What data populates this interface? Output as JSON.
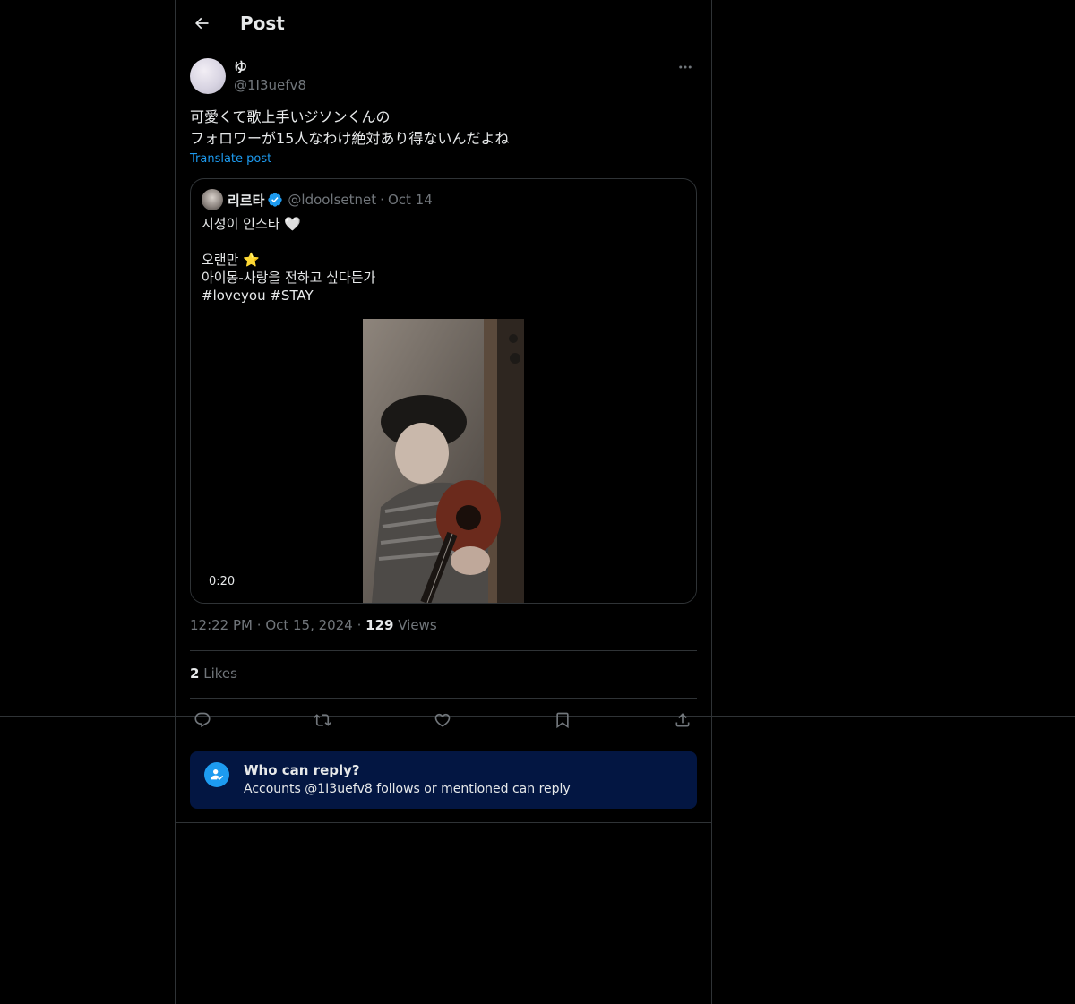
{
  "header": {
    "title": "Post"
  },
  "post": {
    "display_name": "ゆ",
    "handle": "@1I3uefv8",
    "text": "可愛くて歌上手いジソンくんの\nフォロワーが15人なわけ絶対あり得ないんだよね",
    "translate_label": "Translate post",
    "time": "12:22 PM",
    "date": "Oct 15, 2024",
    "views_count": "129",
    "views_label": "Views",
    "likes_count": "2",
    "likes_label": "Likes"
  },
  "quote": {
    "display_name": "리르타",
    "handle": "@ldoolsetnet",
    "date": "Oct 14",
    "lines": [
      "지성이 인스타 🤍",
      "오랜만 ⭐",
      "아이몽-사랑을 전하고 싶다든가",
      "#loveyou #STAY"
    ],
    "video_duration": "0:20"
  },
  "reply_settings": {
    "title": "Who can reply?",
    "subtitle": "Accounts @1I3uefv8 follows or mentioned can reply"
  },
  "colors": {
    "background": "#000000",
    "border": "#2f3336",
    "accent": "#1d9bf0",
    "muted": "#71767b",
    "reply_box": "#031642"
  },
  "icons": [
    "back-arrow-icon",
    "more-icon",
    "verified-icon",
    "reply-icon",
    "repost-icon",
    "like-icon",
    "bookmark-icon",
    "share-icon",
    "people-check-icon"
  ]
}
